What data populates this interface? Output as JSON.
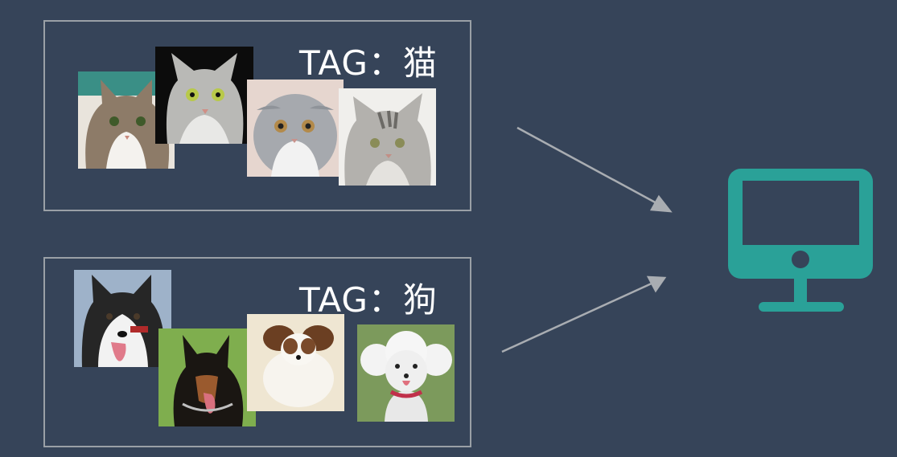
{
  "cat_group": {
    "tag_label": "TAG：猫",
    "photos": [
      "cat-photo",
      "cat-photo",
      "cat-photo",
      "cat-photo"
    ]
  },
  "dog_group": {
    "tag_label": "TAG：狗",
    "photos": [
      "dog-photo",
      "dog-photo",
      "dog-photo",
      "dog-photo"
    ]
  },
  "colors": {
    "background": "#364459",
    "border": "#9aa0a6",
    "arrow": "#a9adb2",
    "monitor": "#2aa198",
    "text": "#ffffff"
  },
  "icons": {
    "monitor": "computer-monitor-icon"
  }
}
